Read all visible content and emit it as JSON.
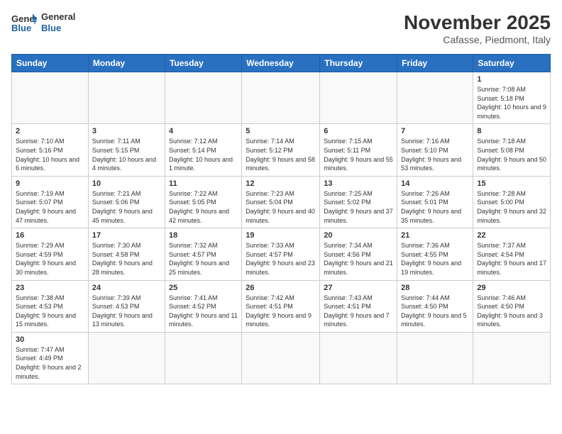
{
  "header": {
    "logo_general": "General",
    "logo_blue": "Blue",
    "title": "November 2025",
    "subtitle": "Cafasse, Piedmont, Italy"
  },
  "weekdays": [
    "Sunday",
    "Monday",
    "Tuesday",
    "Wednesday",
    "Thursday",
    "Friday",
    "Saturday"
  ],
  "weeks": [
    [
      {
        "day": "",
        "info": ""
      },
      {
        "day": "",
        "info": ""
      },
      {
        "day": "",
        "info": ""
      },
      {
        "day": "",
        "info": ""
      },
      {
        "day": "",
        "info": ""
      },
      {
        "day": "",
        "info": ""
      },
      {
        "day": "1",
        "info": "Sunrise: 7:08 AM\nSunset: 5:18 PM\nDaylight: 10 hours and 9 minutes."
      }
    ],
    [
      {
        "day": "2",
        "info": "Sunrise: 7:10 AM\nSunset: 5:16 PM\nDaylight: 10 hours and 6 minutes."
      },
      {
        "day": "3",
        "info": "Sunrise: 7:11 AM\nSunset: 5:15 PM\nDaylight: 10 hours and 4 minutes."
      },
      {
        "day": "4",
        "info": "Sunrise: 7:12 AM\nSunset: 5:14 PM\nDaylight: 10 hours and 1 minute."
      },
      {
        "day": "5",
        "info": "Sunrise: 7:14 AM\nSunset: 5:12 PM\nDaylight: 9 hours and 58 minutes."
      },
      {
        "day": "6",
        "info": "Sunrise: 7:15 AM\nSunset: 5:11 PM\nDaylight: 9 hours and 55 minutes."
      },
      {
        "day": "7",
        "info": "Sunrise: 7:16 AM\nSunset: 5:10 PM\nDaylight: 9 hours and 53 minutes."
      },
      {
        "day": "8",
        "info": "Sunrise: 7:18 AM\nSunset: 5:08 PM\nDaylight: 9 hours and 50 minutes."
      }
    ],
    [
      {
        "day": "9",
        "info": "Sunrise: 7:19 AM\nSunset: 5:07 PM\nDaylight: 9 hours and 47 minutes."
      },
      {
        "day": "10",
        "info": "Sunrise: 7:21 AM\nSunset: 5:06 PM\nDaylight: 9 hours and 45 minutes."
      },
      {
        "day": "11",
        "info": "Sunrise: 7:22 AM\nSunset: 5:05 PM\nDaylight: 9 hours and 42 minutes."
      },
      {
        "day": "12",
        "info": "Sunrise: 7:23 AM\nSunset: 5:04 PM\nDaylight: 9 hours and 40 minutes."
      },
      {
        "day": "13",
        "info": "Sunrise: 7:25 AM\nSunset: 5:02 PM\nDaylight: 9 hours and 37 minutes."
      },
      {
        "day": "14",
        "info": "Sunrise: 7:26 AM\nSunset: 5:01 PM\nDaylight: 9 hours and 35 minutes."
      },
      {
        "day": "15",
        "info": "Sunrise: 7:28 AM\nSunset: 5:00 PM\nDaylight: 9 hours and 32 minutes."
      }
    ],
    [
      {
        "day": "16",
        "info": "Sunrise: 7:29 AM\nSunset: 4:59 PM\nDaylight: 9 hours and 30 minutes."
      },
      {
        "day": "17",
        "info": "Sunrise: 7:30 AM\nSunset: 4:58 PM\nDaylight: 9 hours and 28 minutes."
      },
      {
        "day": "18",
        "info": "Sunrise: 7:32 AM\nSunset: 4:57 PM\nDaylight: 9 hours and 25 minutes."
      },
      {
        "day": "19",
        "info": "Sunrise: 7:33 AM\nSunset: 4:57 PM\nDaylight: 9 hours and 23 minutes."
      },
      {
        "day": "20",
        "info": "Sunrise: 7:34 AM\nSunset: 4:56 PM\nDaylight: 9 hours and 21 minutes."
      },
      {
        "day": "21",
        "info": "Sunrise: 7:36 AM\nSunset: 4:55 PM\nDaylight: 9 hours and 19 minutes."
      },
      {
        "day": "22",
        "info": "Sunrise: 7:37 AM\nSunset: 4:54 PM\nDaylight: 9 hours and 17 minutes."
      }
    ],
    [
      {
        "day": "23",
        "info": "Sunrise: 7:38 AM\nSunset: 4:53 PM\nDaylight: 9 hours and 15 minutes."
      },
      {
        "day": "24",
        "info": "Sunrise: 7:39 AM\nSunset: 4:53 PM\nDaylight: 9 hours and 13 minutes."
      },
      {
        "day": "25",
        "info": "Sunrise: 7:41 AM\nSunset: 4:52 PM\nDaylight: 9 hours and 11 minutes."
      },
      {
        "day": "26",
        "info": "Sunrise: 7:42 AM\nSunset: 4:51 PM\nDaylight: 9 hours and 9 minutes."
      },
      {
        "day": "27",
        "info": "Sunrise: 7:43 AM\nSunset: 4:51 PM\nDaylight: 9 hours and 7 minutes."
      },
      {
        "day": "28",
        "info": "Sunrise: 7:44 AM\nSunset: 4:50 PM\nDaylight: 9 hours and 5 minutes."
      },
      {
        "day": "29",
        "info": "Sunrise: 7:46 AM\nSunset: 4:50 PM\nDaylight: 9 hours and 3 minutes."
      }
    ],
    [
      {
        "day": "30",
        "info": "Sunrise: 7:47 AM\nSunset: 4:49 PM\nDaylight: 9 hours and 2 minutes."
      },
      {
        "day": "",
        "info": ""
      },
      {
        "day": "",
        "info": ""
      },
      {
        "day": "",
        "info": ""
      },
      {
        "day": "",
        "info": ""
      },
      {
        "day": "",
        "info": ""
      },
      {
        "day": "",
        "info": ""
      }
    ]
  ]
}
